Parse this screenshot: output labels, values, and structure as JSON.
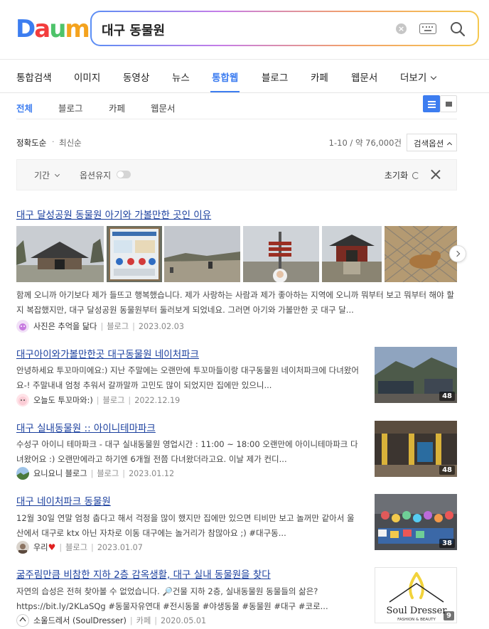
{
  "logo": [
    "D",
    "a",
    "u",
    "m"
  ],
  "search": {
    "query": "대구 동물원"
  },
  "main_tabs": [
    "통합검색",
    "이미지",
    "동영상",
    "뉴스",
    "통합웹",
    "블로그",
    "카페",
    "웹문서",
    "더보기"
  ],
  "sub_tabs": [
    "전체",
    "블로그",
    "카페",
    "웹문서"
  ],
  "sort": {
    "accuracy": "정확도순",
    "dot": "·",
    "recent": "최신순",
    "count": "1-10 / 약 76,000건",
    "options": "검색옵션"
  },
  "filter": {
    "period": "기간",
    "keep": "옵션유지",
    "reset": "초기화"
  },
  "results": [
    {
      "title": "대구 달성공원 동물원 아기와 가볼만한 곳인 이유",
      "snippet": "함께 오니까 아기보다 제가 들뜨고 행복했습니다. 제가 사랑하는 사람과 제가 좋아하는 지역에 오니까 뭐부터 보고 뭐부터 해야 할지 복잡했지만, 대구 달성공원 동물원부터 둘러보게 되었네요. 그러면 아기와 가볼만한 곳 대구 달...",
      "author": "사진은 추억을 닮다",
      "source": "블로그",
      "date": "2023.02.03"
    },
    {
      "title": "대구아이와가볼만한곳 대구동물원 네이처파크",
      "snippet": "안녕하세요 투꼬마미에요:) 지난 주말에는 오랜만에 투꼬마들이랑 대구동물원 네이처파크에 다녀왔어요-! 주말내내 엄청 추워서 갈까말까 고민도 많이 되었지만 집에만 있으니...",
      "author": "오늘도 투꼬마와:)",
      "source": "블로그",
      "date": "2022.12.19",
      "count": "48"
    },
    {
      "title": "대구 실내동물원 :: 아이니테마파크",
      "snippet": "수성구 아이니 테마파크 - 대구 실내동물원 영업시간 : 11:00 ~ 18:00 오랜만에 아이니테마파크 다녀왔어요 :) 오랜만에라고 하기엔 6개월 전쯤 다녀왔더라고요. 이날 제가 컨디...",
      "author": "요니요니 블로그",
      "source": "블로그",
      "date": "2023.01.12",
      "count": "48"
    },
    {
      "title": "대구 네이처파크 동물원",
      "snippet": "12월 30일 연말 엄청 춥다고 해서 걱정을 많이 했지만 집에만 있으면 티비만 보고 놀꺼만 같아서 울산에서 대구로 ktx 아닌 자차로 이동  대구에는 놀거리가 참많아요 ;) #대구동...",
      "author": "우리",
      "source": "블로그",
      "date": "2023.01.07",
      "count": "38"
    },
    {
      "title": "굶주림만큼 비참한 지하 2층 감옥생활, 대구 실내 동물원을 찾다",
      "snippet": "자연의 습성은 전혀 찾아볼 수 없었습니다.   🔎건물 지하 2층, 실내동물원 동물들의 삶은? https://bit.ly/2KLaSQg   #동물자유연대 #전시동물 #야생동물 #동물원 #대구 #코로...",
      "author": "소울드레서 (SoulDresser)",
      "source": "카페",
      "date": "2020.05.01",
      "count": "9"
    }
  ],
  "thumb_logo": {
    "brand": "Soul Dresser",
    "tagline": "FASHION & BEAUTY"
  }
}
